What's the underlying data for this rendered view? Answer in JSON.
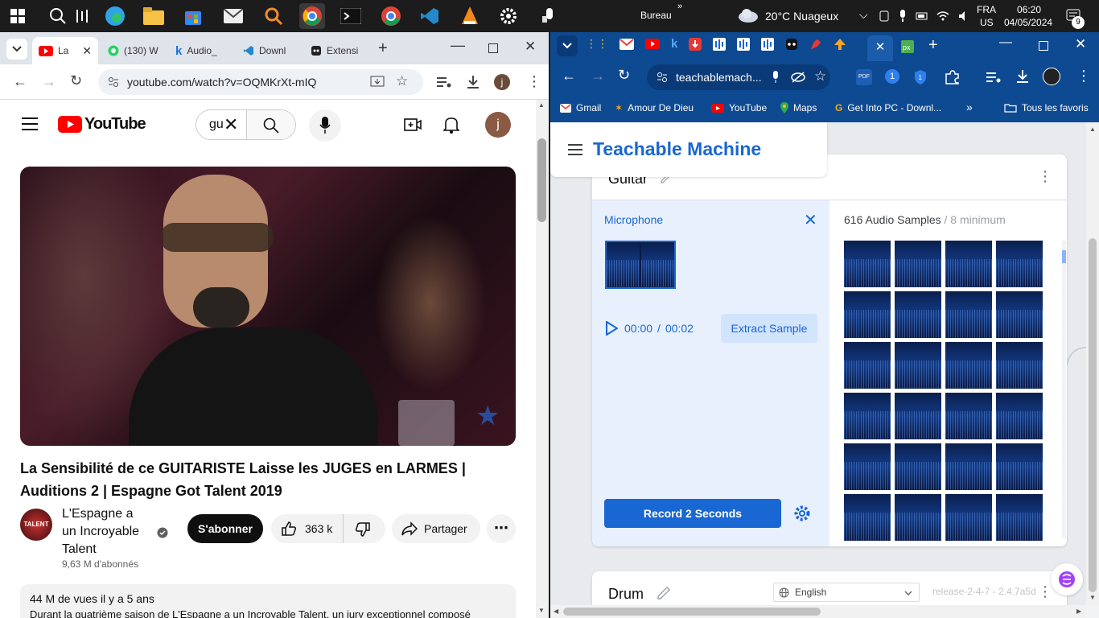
{
  "taskbar": {
    "location_label": "Bureau",
    "weather": "20°C  Nuageux",
    "lang_top": "FRA",
    "lang_bottom": "US",
    "time": "06:20",
    "date": "04/05/2024",
    "notif_count": "9"
  },
  "left_browser": {
    "tabs": [
      {
        "label": "La",
        "icon": "youtube-icon"
      },
      {
        "label": "(130) W",
        "icon": "whatsapp-icon"
      },
      {
        "label": "Audio_",
        "icon": "k-icon"
      },
      {
        "label": "Downl",
        "icon": "vscode-icon"
      },
      {
        "label": "Extensi",
        "icon": "extension-icon"
      }
    ],
    "url": "youtube.com/watch?v=OQMKrXt-mIQ",
    "avatar_letter": "j"
  },
  "youtube": {
    "logo_text": "YouTube",
    "search_value": "gu",
    "video_title": "La Sensibilité de ce GUITARISTE Laisse les JUGES en LARMES | Auditions 2 | Espagne Got Talent 2019",
    "channel_logo_text": "TALENT",
    "channel_name": "L'Espagne a un Incroyable Talent",
    "subscribers": "9,63 M d'abonnés",
    "subscribe_label": "S'abonner",
    "likes": "363 k",
    "share_label": "Partager",
    "views_line": "44 M de vues  il y a 5 ans",
    "description": "Durant la quatrième saison de L'Espagne a un Incroyable Talent, un jury exceptionnel composé",
    "avatar_letter": "j"
  },
  "right_browser": {
    "url": "teachablemach...",
    "ext_badge": "1",
    "bookmarks": [
      "Gmail",
      "Amour De Dieu",
      "YouTube",
      "Maps",
      "Get Into PC - Downl...",
      "Tous les favoris"
    ]
  },
  "teachable": {
    "app_title": "Teachable Machine",
    "class1_name": "Guitar",
    "mic_label": "Microphone",
    "time_current": "00:00",
    "time_sep": "/",
    "time_total": "00:02",
    "extract_label": "Extract Sample",
    "samples_count": "616 Audio Samples",
    "samples_min": "/ 8 minimum",
    "record_label": "Record 2 Seconds",
    "class2_name": "Drum",
    "language": "English",
    "release": "release-2-4-7 - 2.4.7a5d"
  },
  "colors": {
    "tm_blue": "#1967d2",
    "youtube_red": "#ff0000",
    "chrome_blue": "#0e4a92"
  }
}
